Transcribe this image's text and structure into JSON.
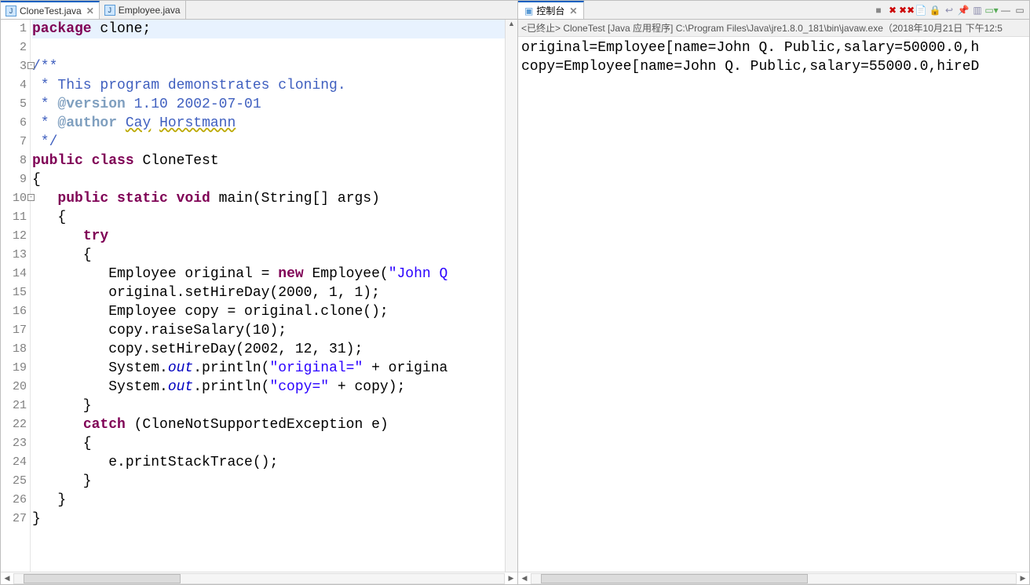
{
  "editor": {
    "tabs": [
      {
        "label": "CloneTest.java",
        "active": true
      },
      {
        "label": "Employee.java",
        "active": false
      }
    ],
    "lines": [
      {
        "num": "1",
        "hl": true,
        "segments": [
          {
            "t": "package",
            "c": "kw"
          },
          {
            "t": " clone;",
            "c": ""
          }
        ]
      },
      {
        "num": "2",
        "segments": []
      },
      {
        "num": "3",
        "fold": true,
        "segments": [
          {
            "t": "/**",
            "c": "com"
          }
        ]
      },
      {
        "num": "4",
        "segments": [
          {
            "t": " * This program demonstrates cloning.",
            "c": "com"
          }
        ]
      },
      {
        "num": "5",
        "segments": [
          {
            "t": " * ",
            "c": "com"
          },
          {
            "t": "@version",
            "c": "tag"
          },
          {
            "t": " 1.10 2002-07-01",
            "c": "com"
          }
        ]
      },
      {
        "num": "6",
        "segments": [
          {
            "t": " * ",
            "c": "com"
          },
          {
            "t": "@author",
            "c": "tag"
          },
          {
            "t": " ",
            "c": "com"
          },
          {
            "t": "Cay",
            "c": "com underline-yellow"
          },
          {
            "t": " ",
            "c": "com"
          },
          {
            "t": "Horstmann",
            "c": "com underline-yellow"
          }
        ]
      },
      {
        "num": "7",
        "segments": [
          {
            "t": " */",
            "c": "com"
          }
        ]
      },
      {
        "num": "8",
        "segments": [
          {
            "t": "public",
            "c": "kw"
          },
          {
            "t": " ",
            "c": ""
          },
          {
            "t": "class",
            "c": "kw"
          },
          {
            "t": " CloneTest",
            "c": ""
          }
        ]
      },
      {
        "num": "9",
        "segments": [
          {
            "t": "{",
            "c": ""
          }
        ]
      },
      {
        "num": "10",
        "fold": true,
        "segments": [
          {
            "t": "   ",
            "c": ""
          },
          {
            "t": "public",
            "c": "kw"
          },
          {
            "t": " ",
            "c": ""
          },
          {
            "t": "static",
            "c": "kw"
          },
          {
            "t": " ",
            "c": ""
          },
          {
            "t": "void",
            "c": "kw"
          },
          {
            "t": " main(String[] args)",
            "c": ""
          }
        ]
      },
      {
        "num": "11",
        "segments": [
          {
            "t": "   {",
            "c": ""
          }
        ]
      },
      {
        "num": "12",
        "segments": [
          {
            "t": "      ",
            "c": ""
          },
          {
            "t": "try",
            "c": "kw"
          }
        ]
      },
      {
        "num": "13",
        "segments": [
          {
            "t": "      {",
            "c": ""
          }
        ]
      },
      {
        "num": "14",
        "segments": [
          {
            "t": "         Employee original = ",
            "c": ""
          },
          {
            "t": "new",
            "c": "kw"
          },
          {
            "t": " Employee(",
            "c": ""
          },
          {
            "t": "\"John Q",
            "c": "str"
          }
        ]
      },
      {
        "num": "15",
        "segments": [
          {
            "t": "         original.setHireDay(2000, 1, 1);",
            "c": ""
          }
        ]
      },
      {
        "num": "16",
        "segments": [
          {
            "t": "         Employee copy = original.clone();",
            "c": ""
          }
        ]
      },
      {
        "num": "17",
        "segments": [
          {
            "t": "         copy.raiseSalary(10);",
            "c": ""
          }
        ]
      },
      {
        "num": "18",
        "segments": [
          {
            "t": "         copy.setHireDay(2002, 12, 31);",
            "c": ""
          }
        ]
      },
      {
        "num": "19",
        "segments": [
          {
            "t": "         System.",
            "c": ""
          },
          {
            "t": "out",
            "c": "sit"
          },
          {
            "t": ".println(",
            "c": ""
          },
          {
            "t": "\"original=\"",
            "c": "str"
          },
          {
            "t": " + origina",
            "c": ""
          }
        ]
      },
      {
        "num": "20",
        "segments": [
          {
            "t": "         System.",
            "c": ""
          },
          {
            "t": "out",
            "c": "sit"
          },
          {
            "t": ".println(",
            "c": ""
          },
          {
            "t": "\"copy=\"",
            "c": "str"
          },
          {
            "t": " + copy);",
            "c": ""
          }
        ]
      },
      {
        "num": "21",
        "segments": [
          {
            "t": "      }",
            "c": ""
          }
        ]
      },
      {
        "num": "22",
        "segments": [
          {
            "t": "      ",
            "c": ""
          },
          {
            "t": "catch",
            "c": "kw"
          },
          {
            "t": " (CloneNotSupportedException e)",
            "c": ""
          }
        ]
      },
      {
        "num": "23",
        "segments": [
          {
            "t": "      {",
            "c": ""
          }
        ]
      },
      {
        "num": "24",
        "segments": [
          {
            "t": "         e.printStackTrace();",
            "c": ""
          }
        ]
      },
      {
        "num": "25",
        "segments": [
          {
            "t": "      }",
            "c": ""
          }
        ]
      },
      {
        "num": "26",
        "segments": [
          {
            "t": "   }",
            "c": ""
          }
        ]
      },
      {
        "num": "27",
        "segments": [
          {
            "t": "}",
            "c": ""
          }
        ]
      }
    ]
  },
  "console": {
    "tab_title": "控制台",
    "terminated": "<已终止> CloneTest [Java 应用程序] C:\\Program Files\\Java\\jre1.8.0_181\\bin\\javaw.exe（2018年10月21日 下午12:5",
    "output": [
      "original=Employee[name=John Q. Public,salary=50000.0,h",
      "copy=Employee[name=John Q. Public,salary=55000.0,hireD"
    ]
  }
}
